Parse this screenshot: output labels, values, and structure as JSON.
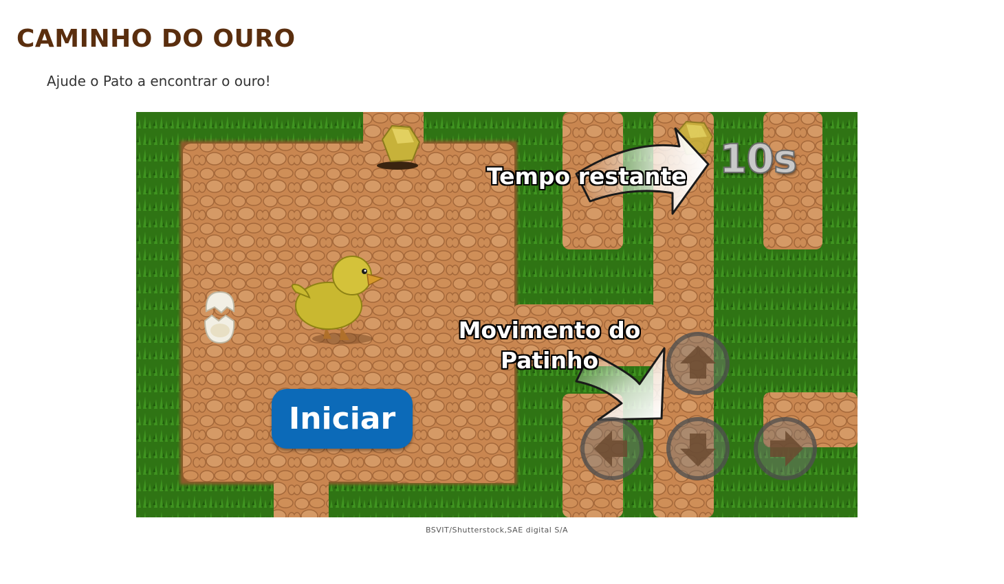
{
  "header": {
    "title": "CAMINHO DO OURO",
    "subtitle": "Ajude o Pato a encontrar o ouro!"
  },
  "game": {
    "timer_value": "10s",
    "callout_timer": "Tempo restante",
    "callout_movement_line1": "Movimento do",
    "callout_movement_line2": "Patinho",
    "start_label": "Iniciar",
    "controls": [
      "up-arrow-icon",
      "left-arrow-icon",
      "down-arrow-icon",
      "right-arrow-icon"
    ],
    "colors": {
      "grass": "#2d6e12",
      "path": "#c98650",
      "button": "#0c6ab8",
      "title": "#5a2e0e"
    }
  },
  "footer": {
    "credit": "BSVIT/Shutterstock,SAE digital S/A"
  }
}
